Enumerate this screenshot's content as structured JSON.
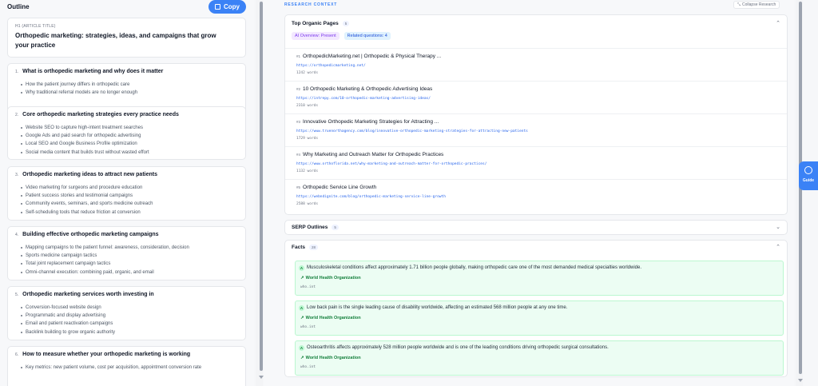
{
  "outline": {
    "title": "Outline",
    "copy_label": "Copy",
    "h1_label": "H1 (ARTICLE TITLE)",
    "h1_text": "Orthopedic marketing: strategies, ideas, and campaigns that grow your practice",
    "sections": [
      {
        "num": "1.",
        "title": "What is orthopedic marketing and why does it matter",
        "bullets": [
          "How the patient journey differs in orthopedic care",
          "Why traditional referral models are no longer enough"
        ]
      },
      {
        "num": "2.",
        "title": "Core orthopedic marketing strategies every practice needs",
        "bullets": [
          "Website SEO to capture high-intent treatment searches",
          "Google Ads and paid search for orthopedic advertising",
          "Local SEO and Google Business Profile optimization",
          "Social media content that builds trust without wasted effort"
        ]
      },
      {
        "num": "3.",
        "title": "Orthopedic marketing ideas to attract new patients",
        "bullets": [
          "Video marketing for surgeons and procedure education",
          "Patient success stories and testimonial campaigns",
          "Community events, seminars, and sports medicine outreach",
          "Self-scheduling tools that reduce friction at conversion"
        ]
      },
      {
        "num": "4.",
        "title": "Building effective orthopedic marketing campaigns",
        "bullets": [
          "Mapping campaigns to the patient funnel: awareness, consideration, decision",
          "Sports medicine campaign tactics",
          "Total joint replacement campaign tactics",
          "Omni-channel execution: combining paid, organic, and email"
        ]
      },
      {
        "num": "5.",
        "title": "Orthopedic marketing services worth investing in",
        "bullets": [
          "Conversion-focused website design",
          "Programmatic and display advertising",
          "Email and patient reactivation campaigns",
          "Backlink building to grow organic authority"
        ]
      },
      {
        "num": "6.",
        "title": "How to measure whether your orthopedic marketing is working",
        "bullets": [
          "Key metrics: new patient volume, cost per acquisition, appointment conversion rate"
        ]
      }
    ]
  },
  "research": {
    "label": "RESEARCH CONTEXT",
    "collapse_label": "Collapse Research",
    "top_pages": {
      "title": "Top Organic Pages",
      "count": "5",
      "ai_overview": "AI Overview: Present",
      "related_questions": "Related questions: 4",
      "items": [
        {
          "num": "#1",
          "title": "OrthopedicMarketing.net | Orthopedic & Physical Therapy ...",
          "url": "https://orthopedicmarketing.net/",
          "words": "1242 words"
        },
        {
          "num": "#2",
          "title": "10 Orthopedic Marketing & Orthopedic Advertising Ideas",
          "url": "https://intrepy.com/10-orthopedic-marketing-advertising-ideas/",
          "words": "2310 words"
        },
        {
          "num": "#3",
          "title": "Innovative Orthopedic Marketing Strategies for Attracting ...",
          "url": "https://www.truenorthagency.com/blog/innovative-orthopedic-marketing-strategies-for-attracting-new-patients",
          "words": "1729 words"
        },
        {
          "num": "#4",
          "title": "Why Marketing and Outreach Matter for Orthopedic Practices",
          "url": "https://www.orthoflorida.net/why-marketing-and-outreach-matter-for-orthopedic-practices/",
          "words": "1132 words"
        },
        {
          "num": "#5",
          "title": "Orthopedic Service Line Growth",
          "url": "https://webndignite.com/blog/orthopedic-marketing-service-line-growth",
          "words": "2588 words"
        }
      ]
    },
    "serp": {
      "title": "SERP Outlines",
      "count": "5"
    },
    "facts": {
      "title": "Facts",
      "count": "28",
      "items": [
        {
          "badge": "A",
          "text": "Musculoskeletal conditions affect approximately 1.71 billion people globally, making orthopedic care one of the most demanded medical specialties worldwide.",
          "source": "World Health Organization",
          "domain": "who.int"
        },
        {
          "badge": "A",
          "text": "Low back pain is the single leading cause of disability worldwide, affecting an estimated 568 million people at any one time.",
          "source": "World Health Organization",
          "domain": "who.int"
        },
        {
          "badge": "A",
          "text": "Osteoarthritis affects approximately 528 million people worldwide and is one of the leading conditions driving orthopedic surgical consultations.",
          "source": "World Health Organization",
          "domain": "who.int"
        }
      ]
    }
  },
  "guide": {
    "label": "Guide"
  },
  "colors": {
    "accent": "#3b82f6",
    "fact_bg": "#ecfdf3",
    "fact_source": "#15803d"
  }
}
